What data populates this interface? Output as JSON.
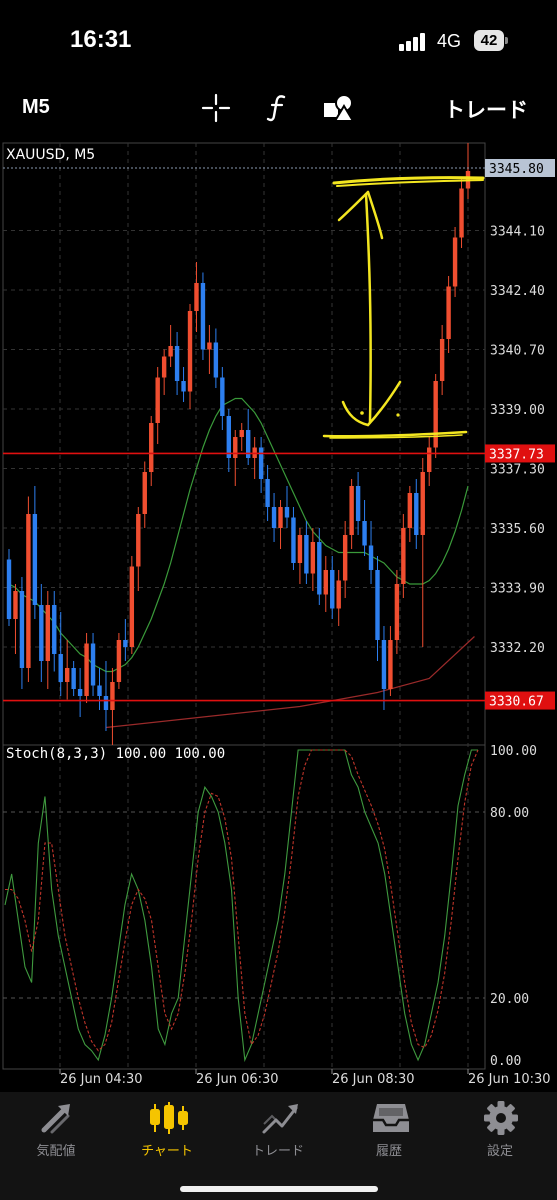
{
  "status_bar": {
    "time": "16:31",
    "network": "4G",
    "battery": "42"
  },
  "toolbar": {
    "timeframe": "M5",
    "trade_label": "トレード"
  },
  "chart": {
    "symbol_label": "XAUUSD, M5",
    "current_price": "3345.80",
    "price_ticks": [
      "3344.10",
      "3342.40",
      "3340.70",
      "3339.00",
      "3337.30",
      "3335.60",
      "3333.90",
      "3332.20"
    ],
    "red_lines": [
      {
        "label": "3337.73",
        "price": 3337.73
      },
      {
        "label": "3330.67",
        "price": 3330.67
      }
    ],
    "stoch_title": "Stoch(8,3,3) 100.00 100.00",
    "stoch_ticks": [
      "100.00",
      "80.00",
      "20.00",
      "0.00"
    ],
    "time_labels": [
      "26 Jun 04:30",
      "26 Jun 06:30",
      "26 Jun 08:30",
      "26 Jun 10:30"
    ],
    "colors": {
      "bull": "#f04e30",
      "bear": "#2d7ff0",
      "level": "#e01010",
      "ma_green": "#3a9a3a",
      "ma_red": "#9a2a2a",
      "annotation": "#f3e620"
    }
  },
  "chart_data": {
    "type": "candlestick",
    "symbol": "XAUUSD",
    "timeframe": "M5",
    "ylim": [
      3329.4,
      3346.6
    ],
    "candles": [
      [
        3334.7,
        3335.0,
        3332.8,
        3333.0
      ],
      [
        3333.0,
        3334.0,
        3332.0,
        3333.8
      ],
      [
        3333.8,
        3334.2,
        3331.0,
        3331.6
      ],
      [
        3331.6,
        3336.5,
        3331.2,
        3336.0
      ],
      [
        3336.0,
        3336.8,
        3333.0,
        3333.4
      ],
      [
        3333.4,
        3334.0,
        3331.2,
        3331.8
      ],
      [
        3331.8,
        3333.8,
        3331.0,
        3333.4
      ],
      [
        3333.4,
        3333.8,
        3331.5,
        3332.0
      ],
      [
        3332.0,
        3333.2,
        3330.8,
        3331.2
      ],
      [
        3331.2,
        3332.4,
        3330.7,
        3331.6
      ],
      [
        3331.6,
        3331.8,
        3330.8,
        3331.0
      ],
      [
        3331.0,
        3331.6,
        3330.2,
        3330.8
      ],
      [
        3330.8,
        3332.6,
        3330.6,
        3332.3
      ],
      [
        3332.3,
        3332.6,
        3330.8,
        3331.1
      ],
      [
        3331.1,
        3331.6,
        3330.4,
        3330.8
      ],
      [
        3330.8,
        3331.8,
        3329.8,
        3330.4
      ],
      [
        3330.4,
        3331.6,
        3329.4,
        3331.2
      ],
      [
        3331.2,
        3332.6,
        3331.0,
        3332.4
      ],
      [
        3332.4,
        3333.0,
        3331.8,
        3332.2
      ],
      [
        3332.2,
        3334.8,
        3332.0,
        3334.5
      ],
      [
        3334.5,
        3336.2,
        3333.8,
        3336.0
      ],
      [
        3336.0,
        3337.5,
        3335.6,
        3337.2
      ],
      [
        3337.2,
        3338.8,
        3336.8,
        3338.6
      ],
      [
        3338.6,
        3340.2,
        3338.0,
        3339.9
      ],
      [
        3339.9,
        3340.7,
        3339.4,
        3340.5
      ],
      [
        3340.5,
        3341.4,
        3340.2,
        3340.8
      ],
      [
        3340.8,
        3341.2,
        3339.4,
        3339.8
      ],
      [
        3339.8,
        3340.2,
        3339.2,
        3339.5
      ],
      [
        3339.5,
        3342.0,
        3339.0,
        3341.8
      ],
      [
        3341.8,
        3343.2,
        3341.2,
        3342.6
      ],
      [
        3342.6,
        3342.9,
        3340.4,
        3340.7
      ],
      [
        3340.7,
        3341.4,
        3340.0,
        3340.9
      ],
      [
        3340.9,
        3341.3,
        3339.6,
        3339.9
      ],
      [
        3339.9,
        3340.2,
        3338.4,
        3338.8
      ],
      [
        3338.8,
        3339.0,
        3337.2,
        3337.6
      ],
      [
        3337.6,
        3338.4,
        3336.8,
        3338.2
      ],
      [
        3338.2,
        3338.6,
        3337.8,
        3338.4
      ],
      [
        3338.4,
        3339.0,
        3337.4,
        3337.6
      ],
      [
        3337.6,
        3338.2,
        3337.0,
        3337.9
      ],
      [
        3337.9,
        3338.2,
        3336.6,
        3337.0
      ],
      [
        3337.0,
        3337.4,
        3335.8,
        3336.2
      ],
      [
        3336.2,
        3336.6,
        3335.2,
        3335.6
      ],
      [
        3335.6,
        3336.4,
        3335.0,
        3336.2
      ],
      [
        3336.2,
        3336.8,
        3335.6,
        3335.9
      ],
      [
        3335.9,
        3336.2,
        3334.4,
        3334.6
      ],
      [
        3334.6,
        3335.6,
        3334.0,
        3335.4
      ],
      [
        3335.4,
        3335.8,
        3334.0,
        3334.3
      ],
      [
        3334.3,
        3335.6,
        3333.8,
        3335.2
      ],
      [
        3335.2,
        3335.6,
        3333.4,
        3333.7
      ],
      [
        3333.7,
        3334.8,
        3333.2,
        3334.4
      ],
      [
        3334.4,
        3334.8,
        3333.0,
        3333.3
      ],
      [
        3333.3,
        3334.4,
        3332.8,
        3334.1
      ],
      [
        3334.1,
        3335.8,
        3333.6,
        3335.4
      ],
      [
        3335.4,
        3337.0,
        3335.0,
        3336.8
      ],
      [
        3336.8,
        3337.2,
        3335.4,
        3335.8
      ],
      [
        3335.8,
        3336.4,
        3334.8,
        3335.1
      ],
      [
        3335.1,
        3335.8,
        3334.0,
        3334.4
      ],
      [
        3334.4,
        3334.8,
        3331.8,
        3332.4
      ],
      [
        3332.4,
        3332.8,
        3330.4,
        3331.0
      ],
      [
        3331.0,
        3332.8,
        3330.8,
        3332.4
      ],
      [
        3332.4,
        3334.4,
        3332.0,
        3334.0
      ],
      [
        3334.0,
        3336.0,
        3333.6,
        3335.6
      ],
      [
        3335.6,
        3336.8,
        3335.2,
        3336.6
      ],
      [
        3336.6,
        3337.0,
        3335.0,
        3335.4
      ],
      [
        3335.4,
        3337.6,
        3332.2,
        3337.2
      ],
      [
        3337.2,
        3338.2,
        3336.8,
        3337.9
      ],
      [
        3337.9,
        3340.0,
        3337.6,
        3339.8
      ],
      [
        3339.8,
        3341.4,
        3339.4,
        3341.0
      ],
      [
        3341.0,
        3342.8,
        3340.6,
        3342.5
      ],
      [
        3342.5,
        3344.2,
        3342.2,
        3343.9
      ],
      [
        3343.9,
        3345.6,
        3343.6,
        3345.3
      ],
      [
        3345.3,
        3346.6,
        3345.0,
        3345.8
      ]
    ],
    "ma_green": [
      3334.0,
      3333.9,
      3333.7,
      3333.6,
      3333.5,
      3333.3,
      3333.1,
      3332.9,
      3332.6,
      3332.4,
      3332.2,
      3332.0,
      3331.9,
      3331.7,
      3331.6,
      3331.5,
      3331.5,
      3331.6,
      3331.7,
      3331.9,
      3332.2,
      3332.6,
      3333.0,
      3333.5,
      3334.0,
      3334.6,
      3335.3,
      3336.0,
      3336.7,
      3337.3,
      3337.9,
      3338.4,
      3338.8,
      3339.1,
      3339.2,
      3339.3,
      3339.3,
      3339.1,
      3338.9,
      3338.6,
      3338.2,
      3337.8,
      3337.4,
      3337.0,
      3336.6,
      3336.2,
      3335.8,
      3335.5,
      3335.3,
      3335.1,
      3335.0,
      3334.9,
      3334.9,
      3334.9,
      3334.9,
      3334.9,
      3334.8,
      3334.7,
      3334.6,
      3334.4,
      3334.2,
      3334.1,
      3334.0,
      3334.0,
      3334.0,
      3334.1,
      3334.3,
      3334.6,
      3335.0,
      3335.5,
      3336.1,
      3336.8
    ],
    "ma_red_points": [
      [
        15,
        3329.9
      ],
      [
        30,
        3330.2
      ],
      [
        45,
        3330.5
      ],
      [
        57,
        3330.9
      ],
      [
        65,
        3331.3
      ],
      [
        72,
        3332.5
      ]
    ],
    "stoch_k": [
      50,
      60,
      45,
      30,
      25,
      70,
      85,
      55,
      40,
      30,
      20,
      10,
      5,
      3,
      0,
      8,
      20,
      35,
      50,
      60,
      55,
      45,
      30,
      10,
      5,
      15,
      20,
      40,
      60,
      80,
      88,
      85,
      80,
      70,
      55,
      20,
      0,
      5,
      15,
      25,
      35,
      45,
      60,
      80,
      100,
      100,
      100,
      100,
      100,
      100,
      100,
      100,
      92,
      88,
      80,
      75,
      70,
      60,
      45,
      30,
      15,
      5,
      0,
      5,
      15,
      25,
      40,
      60,
      82,
      92,
      100,
      100
    ],
    "stoch_d": [
      55,
      55,
      52,
      45,
      35,
      45,
      70,
      70,
      55,
      40,
      30,
      20,
      12,
      6,
      3,
      5,
      12,
      25,
      38,
      50,
      55,
      52,
      45,
      30,
      15,
      10,
      15,
      28,
      45,
      65,
      80,
      86,
      85,
      78,
      65,
      40,
      15,
      5,
      8,
      15,
      25,
      35,
      48,
      65,
      85,
      95,
      100,
      100,
      100,
      100,
      100,
      100,
      98,
      92,
      87,
      82,
      76,
      68,
      55,
      40,
      25,
      12,
      5,
      4,
      8,
      16,
      28,
      45,
      65,
      83,
      95,
      100
    ]
  },
  "nav": {
    "tabs": [
      {
        "label": "気配値"
      },
      {
        "label": "チャート"
      },
      {
        "label": "トレード"
      },
      {
        "label": "履歴"
      },
      {
        "label": "設定"
      }
    ]
  }
}
